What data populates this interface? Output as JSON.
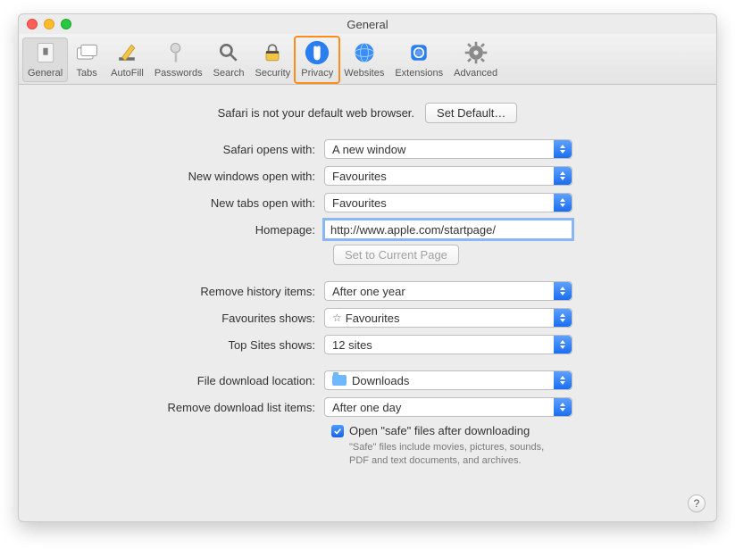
{
  "window": {
    "title": "General"
  },
  "toolbar": {
    "items": [
      {
        "label": "General",
        "selected": true,
        "highlight": false,
        "icon": "general"
      },
      {
        "label": "Tabs",
        "selected": false,
        "highlight": false,
        "icon": "tabs"
      },
      {
        "label": "AutoFill",
        "selected": false,
        "highlight": false,
        "icon": "autofill"
      },
      {
        "label": "Passwords",
        "selected": false,
        "highlight": false,
        "icon": "passwords"
      },
      {
        "label": "Search",
        "selected": false,
        "highlight": false,
        "icon": "search"
      },
      {
        "label": "Security",
        "selected": false,
        "highlight": false,
        "icon": "security"
      },
      {
        "label": "Privacy",
        "selected": false,
        "highlight": true,
        "icon": "privacy"
      },
      {
        "label": "Websites",
        "selected": false,
        "highlight": false,
        "icon": "websites"
      },
      {
        "label": "Extensions",
        "selected": false,
        "highlight": false,
        "icon": "extensions"
      },
      {
        "label": "Advanced",
        "selected": false,
        "highlight": false,
        "icon": "advanced"
      }
    ]
  },
  "defaultBrowser": {
    "message": "Safari is not your default web browser.",
    "button": "Set Default…"
  },
  "form": {
    "opensWith": {
      "label": "Safari opens with:",
      "value": "A new window"
    },
    "newWindows": {
      "label": "New windows open with:",
      "value": "Favourites"
    },
    "newTabs": {
      "label": "New tabs open with:",
      "value": "Favourites"
    },
    "homepage": {
      "label": "Homepage:",
      "value": "http://www.apple.com/startpage/"
    },
    "setCurrent": {
      "label": "Set to Current Page"
    },
    "removeHistory": {
      "label": "Remove history items:",
      "value": "After one year"
    },
    "favShows": {
      "label": "Favourites shows:",
      "value": "Favourites"
    },
    "topSites": {
      "label": "Top Sites shows:",
      "value": "12 sites"
    },
    "downloadLoc": {
      "label": "File download location:",
      "value": "Downloads"
    },
    "removeDownloads": {
      "label": "Remove download list items:",
      "value": "After one day"
    },
    "openSafe": {
      "label": "Open \"safe\" files after downloading",
      "checked": true,
      "note": "\"Safe\" files include movies, pictures, sounds, PDF and text documents, and archives."
    }
  },
  "help": {
    "label": "?"
  }
}
